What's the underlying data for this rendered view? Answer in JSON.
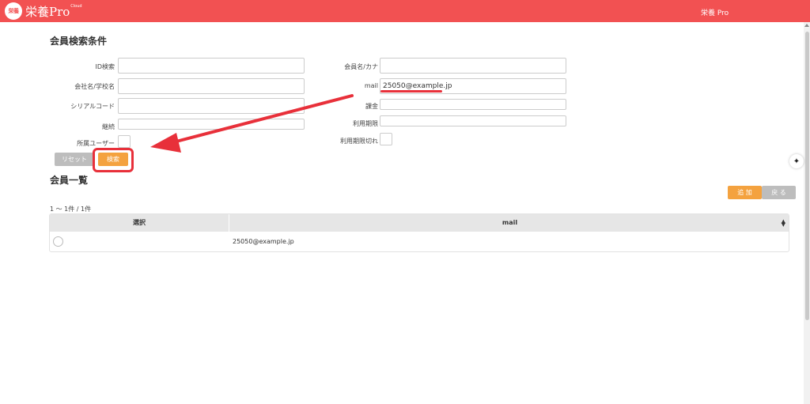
{
  "header": {
    "logo_badge": "栄養",
    "logo_text": "栄養Pro",
    "logo_cloud": "Cloud",
    "user_label": "栄養 Pro",
    "bg_color": "#f25152"
  },
  "search": {
    "title": "会員検索条件",
    "fields": {
      "id_label": "ID検索",
      "id_value": "",
      "name_label": "会員名/カナ",
      "name_value": "",
      "company_label": "会社名/学校名",
      "company_value": "",
      "mail_label": "mail",
      "mail_value": "25050@example.jp",
      "serial_label": "シリアルコード",
      "serial_value": "",
      "billing_label": "課金",
      "billing_value": "",
      "continue_label": "継続",
      "continue_value": "",
      "period_label": "利用期限",
      "period_value": "",
      "affiliated_label": "所属ユーザー",
      "expired_label": "利用期限切れ"
    },
    "reset_label": "リセット",
    "search_label": "検索"
  },
  "list": {
    "title": "会員一覧",
    "add_label": "追 加",
    "back_label": "戻 る",
    "count_text": "1 〜 1件 / 1件",
    "columns": [
      "選択",
      "mail"
    ],
    "rows": [
      {
        "mail": "25050@example.jp"
      }
    ]
  },
  "icons": {
    "sparkle": "sparkle-icon",
    "sort": "sort-icon",
    "arrow": "annotation-arrow"
  },
  "colors": {
    "accent_orange": "#f4a23f",
    "reset_gray": "#bdbdbd",
    "annotation_red": "#e8303a"
  }
}
